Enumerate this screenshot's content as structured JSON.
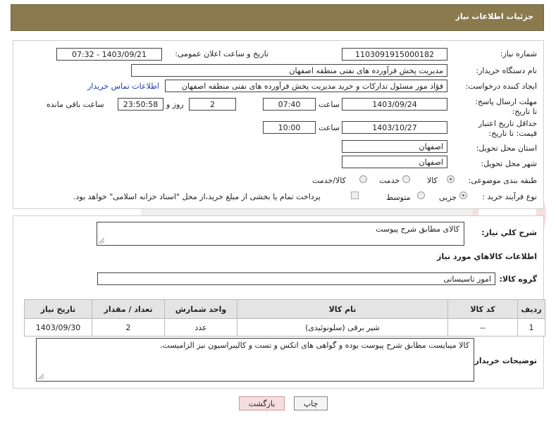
{
  "header": {
    "title": "جزئیات اطلاعات نیاز"
  },
  "form": {
    "need_number": {
      "label": "شماره نیاز:",
      "value": "1103091915000182"
    },
    "announce": {
      "label": "تاریخ و ساعت اعلان عمومی:",
      "value": "1403/09/21 - 07:32"
    },
    "buyer_org": {
      "label": "نام دستگاه خریدار:",
      "value": "مدیریت پخش فرآورده های نفتی منطقه اصفهان"
    },
    "requester": {
      "label": "ایجاد کننده درخواست:",
      "value": "فؤاد مور مسئول تدارکات و خرید مدیریت پخش فرآورده های نفتی منطقه اصفهان",
      "contact_link": "اطلاعات تماس خریدار"
    },
    "deadline": {
      "label": "مهلت ارسال پاسخ: تا تاریخ:",
      "date": "1403/09/24",
      "time_label": "ساعت",
      "time": "07:40",
      "days": "2",
      "days_label": "روز و",
      "remaining": "23:50:58",
      "remaining_label": "ساعت باقی مانده"
    },
    "validity": {
      "label": "حداقل تاریخ اعتبار قیمت: تا تاریخ:",
      "date": "1403/10/27",
      "time_label": "ساعت",
      "time": "10:00"
    },
    "province": {
      "label": "استان محل تحویل:",
      "value": "اصفهان"
    },
    "city": {
      "label": "شهر محل تحویل:",
      "value": "اصفهان"
    },
    "category": {
      "label": "طبقه بندی موضوعی:",
      "options": [
        "کالا",
        "خدمت",
        "کالا/خدمت"
      ],
      "selected": "کالا"
    },
    "process": {
      "label": "نوع فرآیند خرید :",
      "options": [
        "جزیی",
        "متوسط"
      ],
      "selected": "جزیی",
      "note": "پرداخت تمام یا بخشی از مبلغ خرید،از محل \"اسناد خزانه اسلامی\" خواهد بود."
    }
  },
  "details": {
    "summary_label": "شرح کلي نياز:",
    "summary_value": "کالای مطابق شرح پیوست",
    "items_title": "اطلاعات کالاهاي مورد نياز",
    "group_label": "گروه کالا:",
    "group_value": "امور تاسیساتی",
    "table": {
      "headers": [
        "ردیف",
        "کد کالا",
        "نام کالا",
        "واحد شمارش",
        "تعداد / مقدار",
        "تاریخ نیاز"
      ],
      "rows": [
        {
          "row": "1",
          "code": "--",
          "name": "شیر برقی (سلونوئیدی)",
          "unit": "عدد",
          "qty": "2",
          "date": "1403/09/30"
        }
      ]
    },
    "buyer_notes_label": "توضیحات خریدار:",
    "buyer_notes_value": "کالا میبایست مطابق شرح پیوست بوده و گواهی های اتکس و تست و کالیبراسیون نیز الزامیست."
  },
  "buttons": {
    "print": "چاپ",
    "back": "بازگشت"
  },
  "colors": {
    "header_bg": "#8a7a4e",
    "link": "#1a3fb0",
    "back_button": "#f6dede"
  }
}
